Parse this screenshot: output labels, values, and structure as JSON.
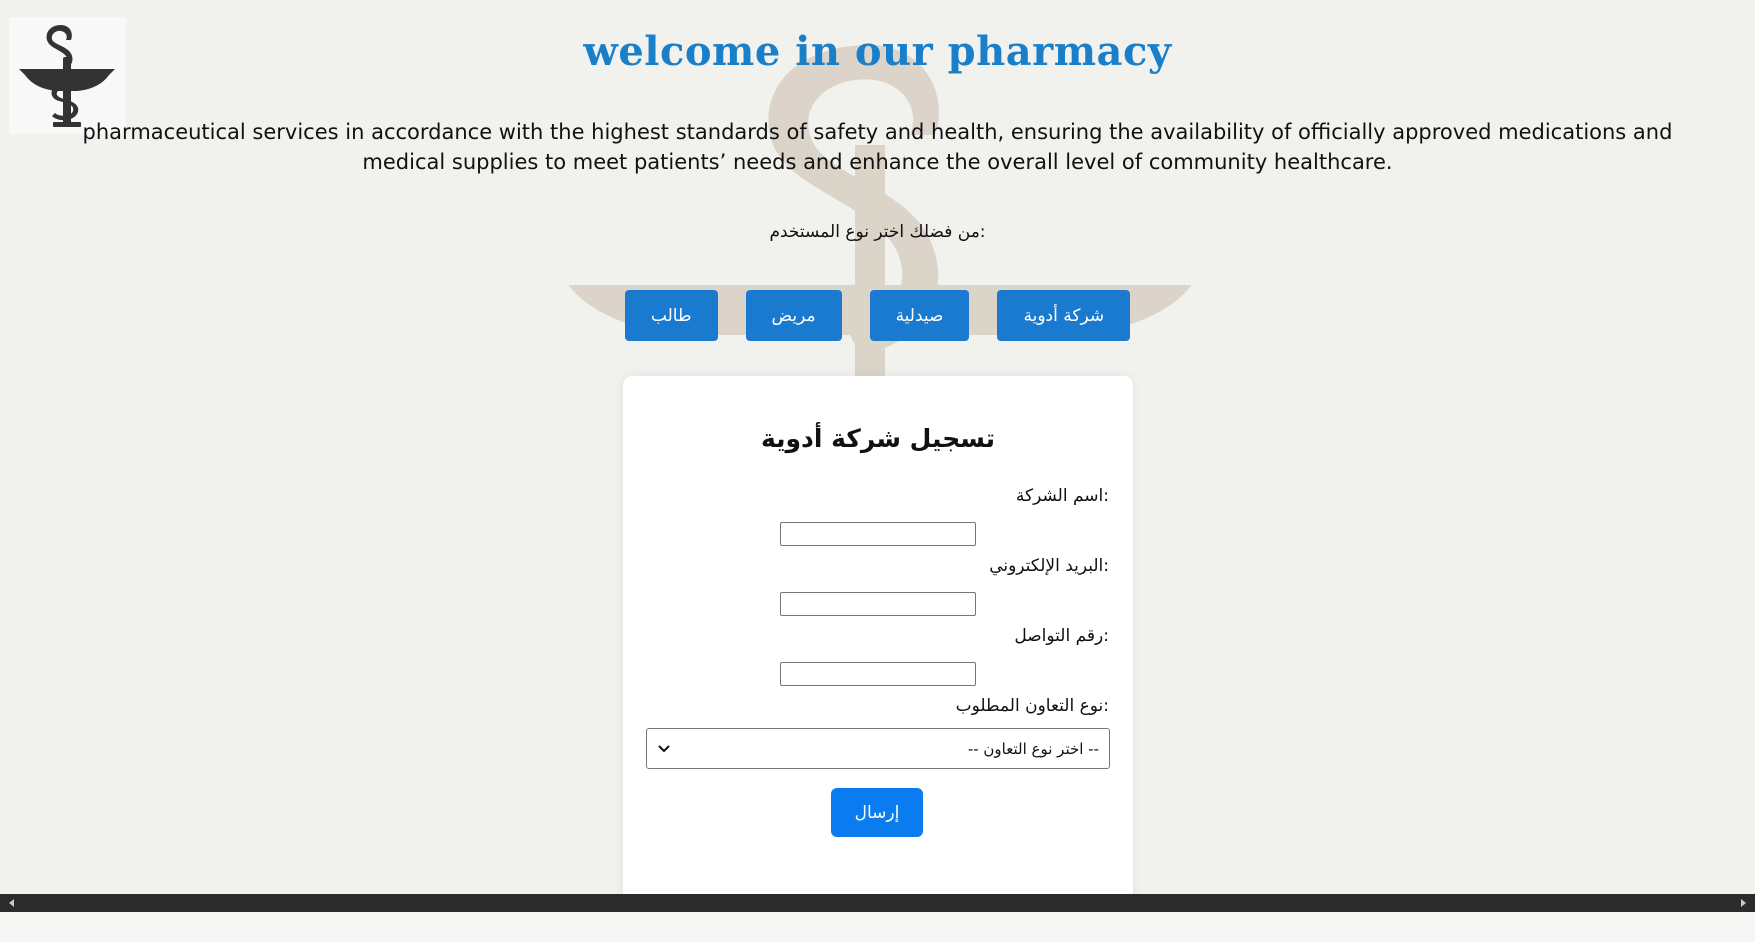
{
  "header": {
    "title": "welcome in our pharmacy",
    "description": "pharmaceutical services in accordance with the highest standards of safety and health, ensuring the availability of officially approved medications and medical supplies to meet patients’ needs and enhance the overall level of community healthcare."
  },
  "user_type": {
    "prompt": ":من فضلك اختر نوع المستخدم",
    "buttons": [
      "شركة أدوية",
      "صيدلية",
      "مريض",
      "طالب"
    ]
  },
  "form": {
    "title": "تسجيل شركة أدوية",
    "fields": [
      {
        "label": ":اسم الشركة",
        "value": ""
      },
      {
        "label": ":البريد الإلكتروني",
        "value": ""
      },
      {
        "label": ":رقم التواصل",
        "value": ""
      }
    ],
    "cooperation": {
      "label": ":نوع التعاون المطلوب",
      "selected": "-- اختر نوع التعاون --"
    },
    "submit_label": "إرسال"
  },
  "colors": {
    "title": "#1a7fc9",
    "button": "#1a7ad0",
    "submit": "#0a7cf0",
    "background": "#f1f1ee"
  },
  "icons": {
    "logo": "caduceus-bowl-of-hygieia-icon",
    "watermark": "caduceus-bowl-of-hygieia-icon",
    "select": "chevron-down-icon",
    "scroll_left": "scroll-arrow-left-icon",
    "scroll_right": "scroll-arrow-right-icon"
  }
}
